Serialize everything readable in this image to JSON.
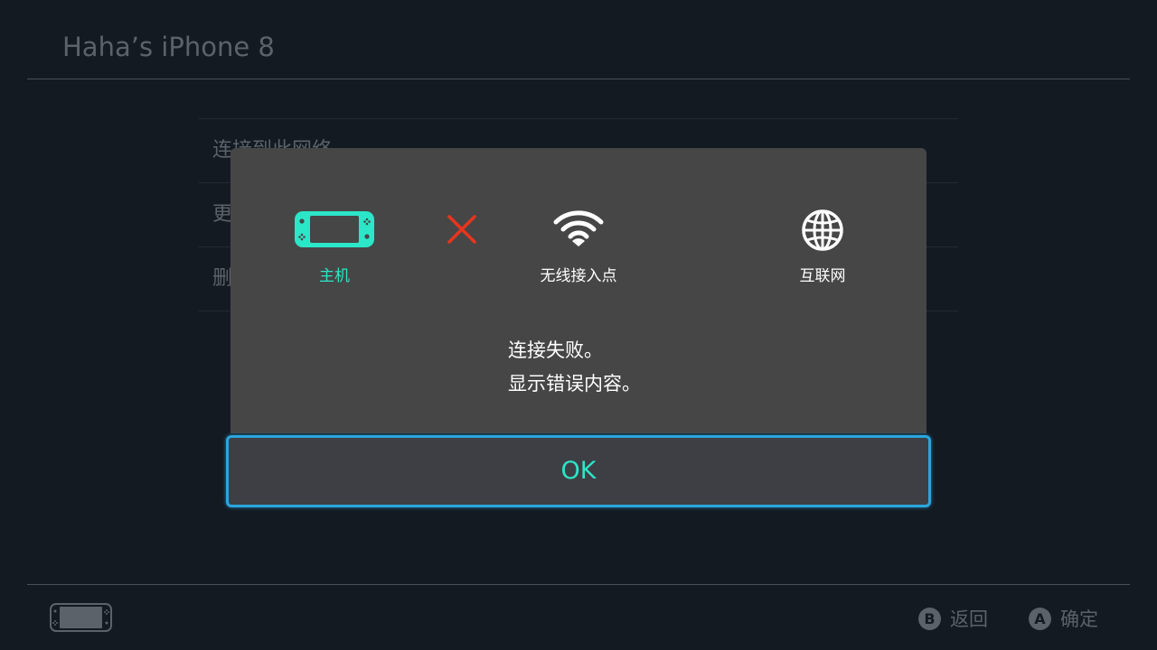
{
  "header": {
    "title": "Haha’s iPhone 8"
  },
  "background_menu": {
    "items": [
      {
        "label": "连接到此网络"
      },
      {
        "label": "更"
      },
      {
        "label": "删"
      }
    ]
  },
  "dialog": {
    "nodes": {
      "console": {
        "label": "主机",
        "icon": "console-icon"
      },
      "access_point": {
        "label": "无线接入点",
        "icon": "wifi-icon"
      },
      "internet": {
        "label": "互联网",
        "icon": "globe-icon"
      }
    },
    "failure_icon": "error-x-icon",
    "message_line1": "连接失败。",
    "message_line2": "显示错误内容。",
    "ok_label": "OK"
  },
  "footer": {
    "back": {
      "button": "B",
      "label": "返回"
    },
    "confirm": {
      "button": "A",
      "label": "确定"
    }
  },
  "colors": {
    "background": "#141a22",
    "dialog": "#464646",
    "accent": "#2ce6c8",
    "focus": "#2aa6dd",
    "error": "#e8351e"
  }
}
